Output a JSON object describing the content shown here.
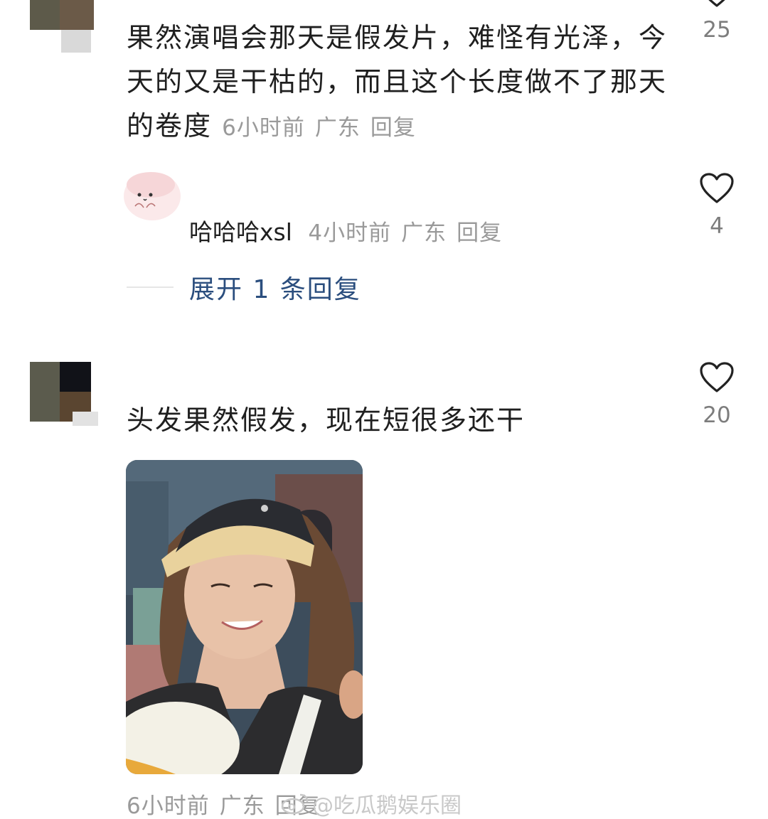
{
  "comments": [
    {
      "text": "果然演唱会那天是假发片，难怪有光泽，今天的又是干枯的，而且这个长度做不了那天的卷度",
      "time": "6小时前",
      "location": "广东",
      "reply_label": "回复",
      "likes": "25",
      "reply": {
        "username": "哈哈哈xsl",
        "time": "4小时前",
        "location": "广东",
        "reply_label": "回复",
        "likes": "4"
      },
      "expand_label": "展开 1 条回复"
    },
    {
      "text": "头发果然假发，现在短很多还干",
      "time": "6小时前",
      "location": "广东",
      "reply_label": "回复",
      "likes": "20"
    }
  ],
  "watermark": "@吃瓜鹅娱乐圈",
  "colors": {
    "link": "#2b4e7e",
    "meta": "#9a9a9a",
    "text": "#1f1f1f"
  },
  "icons": [
    "heart-icon",
    "weibo-logo-icon"
  ]
}
